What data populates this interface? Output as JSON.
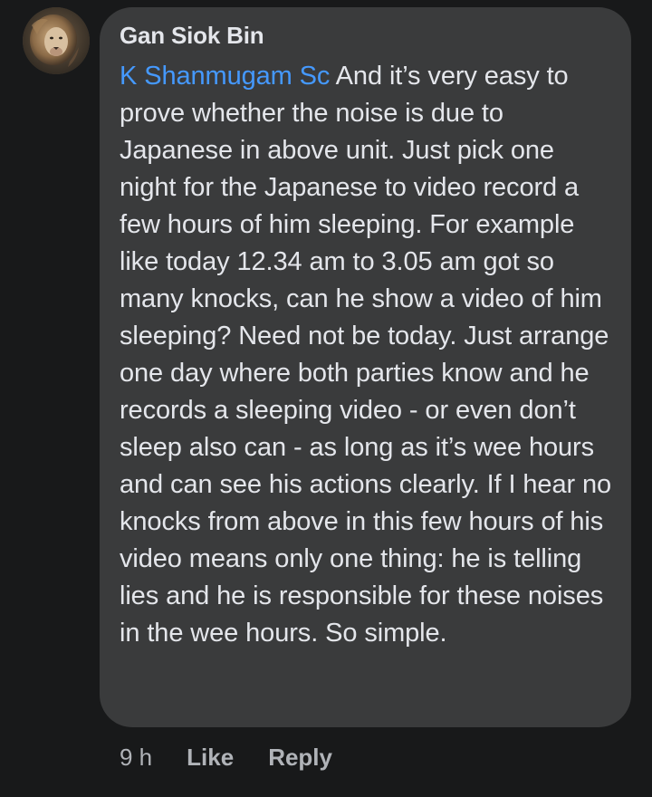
{
  "comment": {
    "avatar_icon": "lion-profile-photo",
    "author": "Gan Siok Bin",
    "mention": "K Shanmugam Sc",
    "text": " And it’s very easy to prove whether the noise is due to Japanese in above unit. Just pick one night for the Japanese to video record a few hours of him sleeping. For example like today 12.34 am to 3.05 am got so many knocks, can he show a video of him sleeping? Need not be today. Just arrange one day where both parties know and he records a sleeping video - or even don’t sleep also can - as long as it’s wee hours and can see his actions clearly. If I hear no knocks from above in this few hours of his video means only one thing: he is telling lies and he is responsible for these noises in the wee hours. So simple.",
    "timestamp": "9 h",
    "like_label": "Like",
    "reply_label": "Reply"
  },
  "colors": {
    "background": "#18191a",
    "bubble": "#3a3b3c",
    "text": "#e4e6eb",
    "mention": "#4599ff",
    "meta": "#b0b3b8"
  }
}
